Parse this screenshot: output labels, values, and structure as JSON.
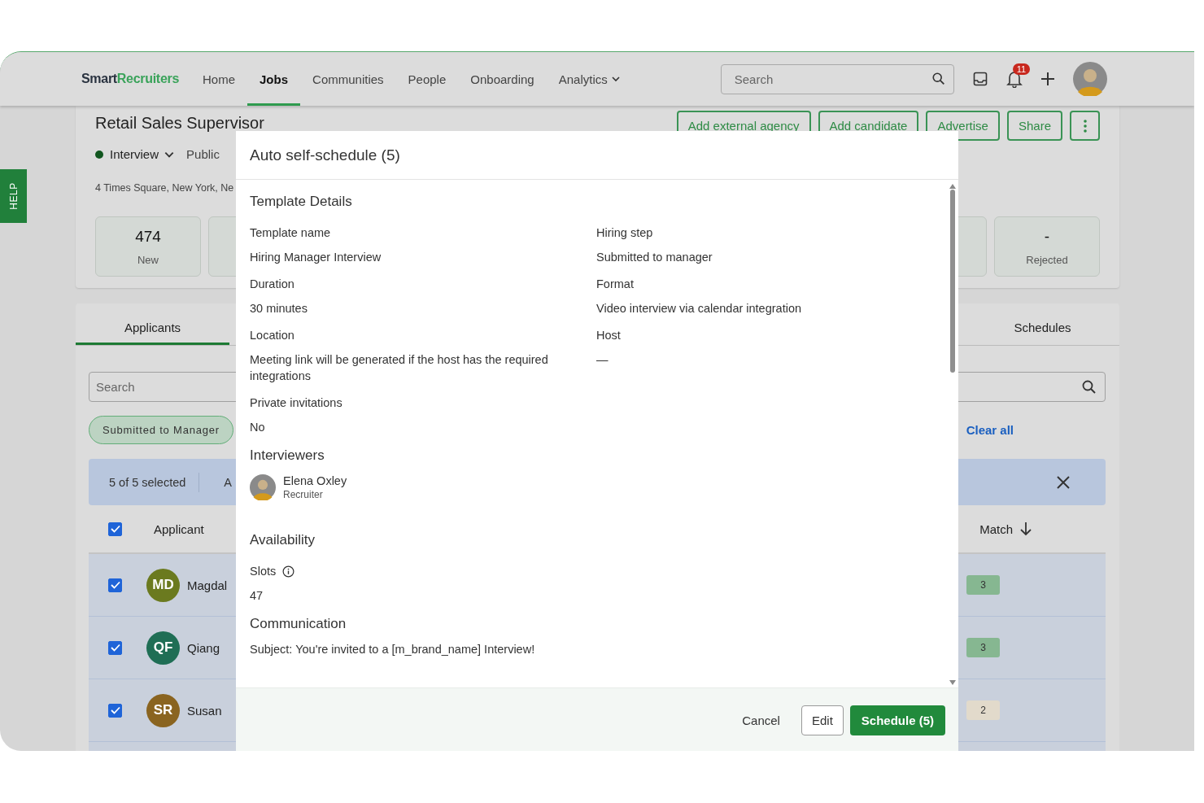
{
  "topbar": {
    "logo": {
      "part1": "Smart",
      "part2": "Recruiters"
    },
    "nav": [
      {
        "label": "Home",
        "selected": false,
        "dropdown": false
      },
      {
        "label": "Jobs",
        "selected": true,
        "dropdown": false
      },
      {
        "label": "Communities",
        "selected": false,
        "dropdown": false
      },
      {
        "label": "People",
        "selected": false,
        "dropdown": false
      },
      {
        "label": "Onboarding",
        "selected": false,
        "dropdown": false
      },
      {
        "label": "Analytics",
        "selected": false,
        "dropdown": true
      }
    ],
    "search": {
      "placeholder": "Search"
    },
    "notifications_badge": "11"
  },
  "help_tab": "HELP",
  "job": {
    "title": "Retail Sales Supervisor",
    "status": "Interview",
    "visibility": "Public",
    "address": "4 Times Square, New York, Ne",
    "actions": [
      "Add external agency",
      "Add candidate",
      "Advertise",
      "Share"
    ],
    "stats_left": [
      {
        "value": "474",
        "label": "New"
      }
    ],
    "stats_right": [
      {
        "value": "-",
        "label": "Rejected"
      }
    ]
  },
  "applicants": {
    "tabs": [
      {
        "label": "Applicants",
        "selected": true
      },
      {
        "label": "Schedules",
        "selected": false
      }
    ],
    "search": {
      "placeholder": "Search"
    },
    "filter_chip": "Submitted to Manager",
    "clear_all": "Clear all",
    "selection": {
      "count": "5 of 5 selected",
      "action": "A"
    },
    "columns": {
      "all_checked": true,
      "applicant": "Applicant",
      "match": "Match"
    },
    "rows": [
      {
        "checked": true,
        "initials": "MD",
        "color": "#6b7a1f",
        "name": "Magdal",
        "match": {
          "score": "3",
          "color": "#86b791"
        }
      },
      {
        "checked": true,
        "initials": "QF",
        "color": "#1f6e55",
        "name": "Qiang",
        "match": {
          "score": "3",
          "color": "#86b791"
        }
      },
      {
        "checked": true,
        "initials": "SR",
        "color": "#8a6420",
        "name": "Susan",
        "match": {
          "score": "2",
          "color": "#e2dacb"
        }
      }
    ]
  },
  "modal": {
    "title": "Auto self-schedule (5)",
    "sections": [
      {
        "kind": "fields",
        "heading": "Template Details",
        "fields": [
          {
            "label": "Template name",
            "value": "Hiring Manager Interview",
            "info": false
          },
          {
            "label": "Hiring step",
            "value": "Submitted to manager",
            "info": false
          },
          {
            "label": "Duration",
            "value": "30 minutes",
            "info": false
          },
          {
            "label": "Format",
            "value": "Video interview via calendar integration",
            "info": false
          },
          {
            "label": "Location",
            "value": "Meeting link will be generated if the host has the required integrations",
            "info": false
          },
          {
            "label": "Host",
            "value": "—",
            "info": false
          },
          {
            "label": "Private invitations",
            "value": "No",
            "info": false
          }
        ]
      },
      {
        "kind": "people",
        "heading": "Interviewers",
        "people": [
          {
            "name": "Elena Oxley",
            "role": "Recruiter"
          }
        ]
      },
      {
        "kind": "fields",
        "heading": "Availability",
        "fields": [
          {
            "label": "Slots",
            "value": "47",
            "info": true
          }
        ]
      },
      {
        "kind": "text",
        "heading": "Communication",
        "text": "Subject:  You're invited to a [m_brand_name] Interview!"
      }
    ],
    "buttons": [
      {
        "kind": "text",
        "label": "Cancel"
      },
      {
        "kind": "outline",
        "label": "Edit"
      },
      {
        "kind": "primary",
        "label": "Schedule (5)"
      }
    ]
  }
}
